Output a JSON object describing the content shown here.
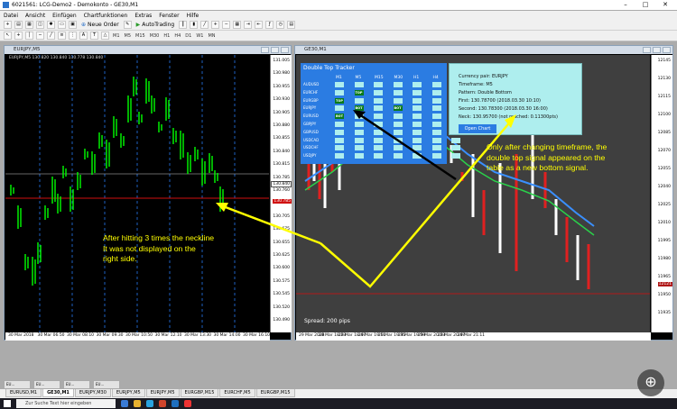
{
  "app": {
    "title": "6021561: LCG-Demo2 - Demokonto - GE30,M1",
    "menu": [
      "Datei",
      "Ansicht",
      "Einfügen",
      "Chartfunktionen",
      "Extras",
      "Fenster",
      "Hilfe"
    ],
    "toolbar": {
      "new_order": "Neue Order",
      "autotrading": "AutoTrading"
    },
    "timeframes": [
      "M1",
      "M5",
      "M15",
      "M30",
      "H1",
      "H4",
      "D1",
      "W1",
      "MN"
    ]
  },
  "left_chart": {
    "title": "EURJPY,M5",
    "header": "EURJPY,M5  130.820 130.840 130.778 130.840",
    "price_labels": [
      "131.005",
      "130.980",
      "130.955",
      "130.930",
      "130.905",
      "130.880",
      "130.855",
      "130.840",
      "130.815",
      "130.785",
      "130.760",
      "130.730",
      "130.705",
      "130.675",
      "130.655",
      "130.625",
      "130.600",
      "130.575",
      "130.545",
      "130.520",
      "130.490"
    ],
    "current_price": "130.840",
    "neckline_price": "130.785",
    "time_labels": [
      "30 Mar 2018",
      "30 Mar 06:50",
      "30 Mar 08:10",
      "30 Mar 09:30",
      "30 Mar 10:50",
      "30 Mar 12:10",
      "30 Mar 13:30",
      "30 Mar 14:00",
      "30 Mar 16:10"
    ],
    "candle_color": "#00ff00",
    "neckline_color": "#d01010"
  },
  "right_chart": {
    "title": "GE30,M1",
    "header": "GE30,M1  12121.19 12121.19 12111.78 12121.78",
    "price_labels": [
      "12145",
      "12130",
      "12115",
      "12100",
      "12085",
      "12070",
      "12055",
      "12040",
      "12025",
      "12010",
      "11995",
      "11980",
      "11965",
      "11950",
      "11935"
    ],
    "current_price_label": "12121",
    "time_labels": [
      "29 Mar 2018",
      "29 Mar 18:23",
      "29 Mar 18:47",
      "29 Mar 19:11",
      "29 Mar 19:35",
      "29 Mar 19:59",
      "29 Mar 20:23",
      "29 Mar 20:47",
      "29 Mar 21:11"
    ],
    "spread": "Spread: 200 pips"
  },
  "tracker": {
    "title": "Double Top Tracker",
    "columns": [
      "M1",
      "M5",
      "M15",
      "M30",
      "H1",
      "H4",
      "D1"
    ],
    "pairs": [
      "AUDUSD",
      "EURCHF",
      "EURGBP",
      "EURJPY",
      "EURUSD",
      "GBPJPY",
      "GBPUSD",
      "USDCAD",
      "USDCHF",
      "USDJPY"
    ],
    "signals": [
      {
        "row": 1,
        "col": 1,
        "label": "TOP"
      },
      {
        "row": 2,
        "col": 0,
        "label": "TOP"
      },
      {
        "row": 3,
        "col": 1,
        "label": "BOT"
      },
      {
        "row": 3,
        "col": 3,
        "label": "BOT"
      },
      {
        "row": 4,
        "col": 0,
        "label": "BOT"
      }
    ],
    "colors": {
      "panel": "#2b7ce2",
      "cell": "#aeeeee",
      "signal": "#0a7b19"
    }
  },
  "info": {
    "currency_pair": "Currency pair: EURJPY",
    "timeframe": "Timeframe: M5",
    "pattern": "Pattern: Double Bottom",
    "first": "First:     130.78700 (2018.03.30 10:10)",
    "second": "Second:  130.78300 (2018.03.30 16:00)",
    "neck": "Neck: 130.95700 (not reached: 0.11300pts)",
    "open_chart": "Open Chart"
  },
  "annotations": {
    "left": [
      "After hitting 3 times the neckline",
      "It was not displayed on the",
      "right side."
    ],
    "right": [
      "Only after changing timeframe, the",
      "double top signal appeared on the",
      "table as a new bottom signal."
    ],
    "color": "#ffff00"
  },
  "minimized_windows": [
    "EU...",
    "EU...",
    "EU...",
    "EU..."
  ],
  "chart_tabs": [
    "EURUSD,M1",
    "GE30,M1",
    "EURJPY,M30",
    "EURJPY,M5",
    "EURJPY,M5",
    "EURGBP,M15",
    "EURCHF,M5",
    "EURGBP,M15"
  ],
  "active_tab": 1,
  "taskbar": {
    "search_placeholder": "Zur Suche Text hier eingeben"
  }
}
